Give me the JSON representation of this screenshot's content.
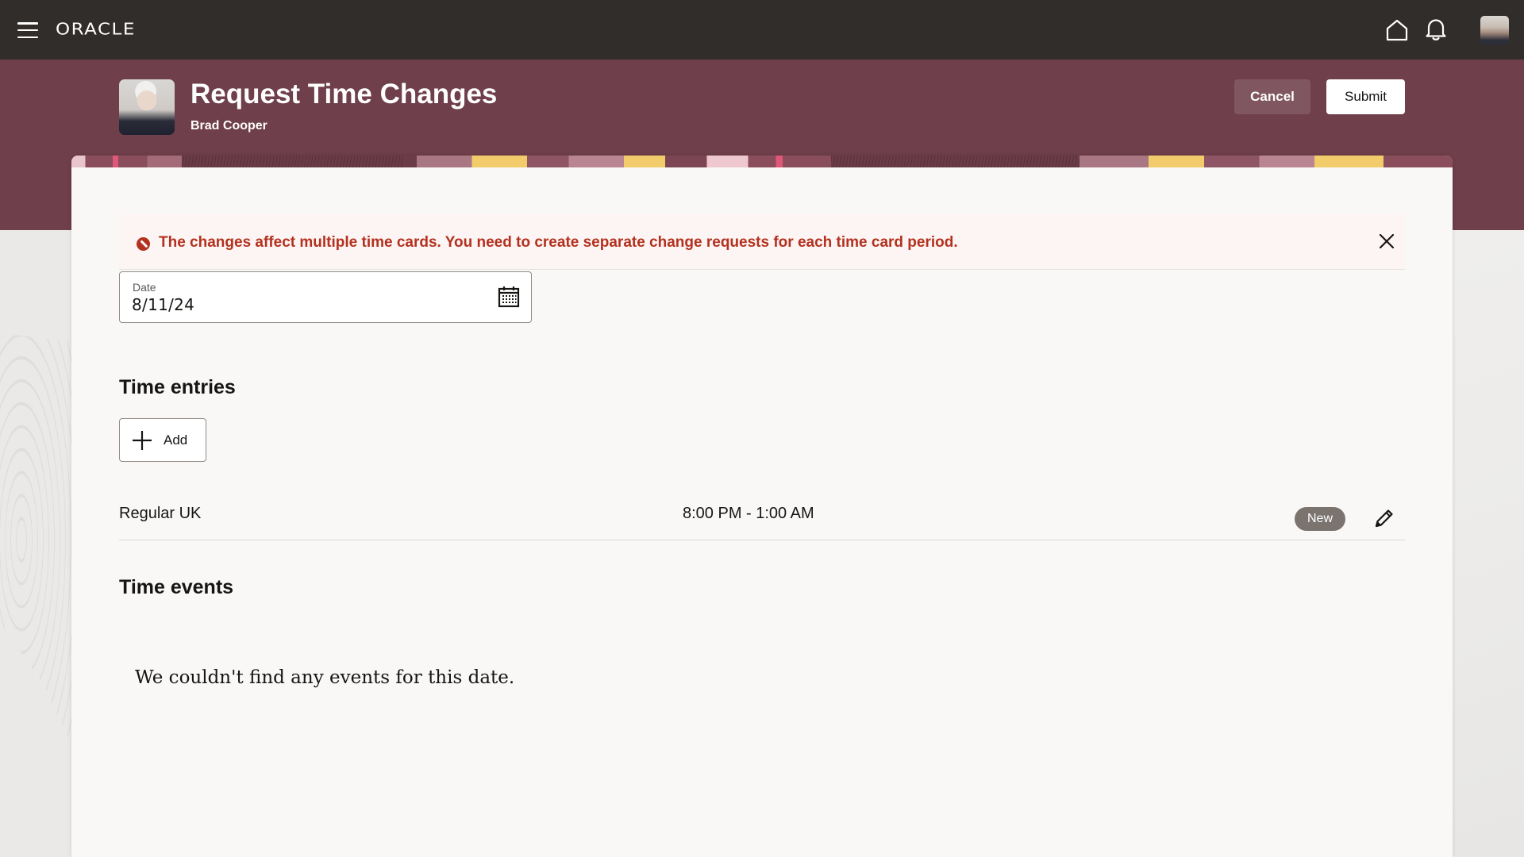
{
  "topbar": {
    "logo": "ORACLE",
    "icons": [
      "hamburger-menu-icon",
      "home-icon",
      "notifications-bell-icon",
      "user-avatar"
    ]
  },
  "header": {
    "title": "Request Time Changes",
    "subtitle": "Brad Cooper",
    "cancel_label": "Cancel",
    "submit_label": "Submit"
  },
  "error_banner": {
    "icon": "error-icon",
    "message": "The changes affect multiple time cards. You need to create separate change requests for each time card period.",
    "close_icon": "close-icon"
  },
  "date_field": {
    "label": "Date",
    "value": "8/11/24",
    "icon": "calendar-icon"
  },
  "time_entries": {
    "title": "Time entries",
    "add_label": "Add",
    "rows": [
      {
        "type": "Regular UK",
        "time": "8:00 PM - 1:00 AM",
        "status": "New"
      }
    ]
  },
  "time_events": {
    "title": "Time events",
    "empty_message": "We couldn't find any events for this date."
  },
  "colors": {
    "topbar_bg": "#312d2a",
    "header_bg": "#6f3f4b",
    "error_text": "#b3311e",
    "error_bg": "#fdf5f4",
    "badge_bg": "#7a736e",
    "card_bg": "#f9f8f6"
  }
}
